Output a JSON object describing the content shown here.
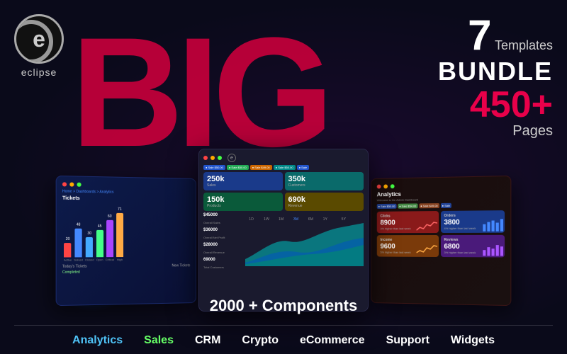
{
  "logo": {
    "symbol": "e",
    "name": "eclipse"
  },
  "hero": {
    "big_text": "BIG",
    "bundle_count": "7",
    "templates_label": "Templates",
    "bundle_label": "BUNDLE",
    "pages_count": "450+",
    "pages_label": "Pages",
    "components_label": "2000 + Components"
  },
  "left_dashboard": {
    "title": "Analytics",
    "breadcrumb": "Home > Dashboards > Analytics",
    "section": "Tickets",
    "bars": [
      {
        "label": "Active",
        "value": 20,
        "color": "#ff4444"
      },
      {
        "label": "Solved",
        "value": 48,
        "color": "#4488ff"
      },
      {
        "label": "Closed",
        "value": 30,
        "color": "#44aaff"
      },
      {
        "label": "Open",
        "value": 45,
        "color": "#44ff88"
      },
      {
        "label": "Critical",
        "value": 60,
        "color": "#aa44ff"
      },
      {
        "label": "High",
        "value": 71,
        "color": "#ffaa44"
      }
    ],
    "today_tickets": "Today's Tickets",
    "new_tickets": "New Tickets",
    "completed": "Completed"
  },
  "center_dashboard": {
    "sale_badges": [
      {
        "label": "Sale $50.00",
        "color": "blue"
      },
      {
        "label": "Sale $50.00",
        "color": "green"
      },
      {
        "label": "Sale $49.00",
        "color": "orange"
      },
      {
        "label": "Sale $50.00",
        "color": "teal"
      },
      {
        "label": "Sale",
        "color": "blue"
      }
    ],
    "stats": [
      {
        "value": "250k",
        "label": "Sales",
        "type": "blue"
      },
      {
        "value": "350k",
        "label": "Customers",
        "type": "teal"
      },
      {
        "value": "150k",
        "label": "Products",
        "type": "green"
      },
      {
        "value": "690k",
        "label": "Revenue",
        "type": "gold"
      }
    ],
    "chart_values": [
      {
        "label": "$45000",
        "desc": "Overall Sales"
      },
      {
        "label": "$36000",
        "desc": "Overall Net Profit"
      },
      {
        "label": "$28000",
        "desc": "Overall Revenue"
      },
      {
        "label": "69000",
        "desc": "Total Customers"
      }
    ]
  },
  "right_dashboard": {
    "title": "Analytics",
    "breadcrumb": "Welcome to the Admin Dashboard",
    "sale_badges": [
      {
        "label": "Sale $50.00"
      },
      {
        "label": "Sale $54.00"
      },
      {
        "label": "Sale $49.00"
      },
      {
        "label": "Sale"
      }
    ],
    "stats": [
      {
        "title": "Clicks",
        "value": "8900",
        "change": "3% higher than last week",
        "type": "red"
      },
      {
        "title": "Orders",
        "value": "3800",
        "change": "4% higher than last week",
        "type": "blue"
      },
      {
        "title": "Income",
        "value": "9600",
        "change": "5% higher than last week",
        "type": "orange"
      },
      {
        "title": "Reviews",
        "value": "6800",
        "change": "3% higher than last week",
        "type": "purple"
      }
    ]
  },
  "bottom_nav": {
    "items": [
      {
        "label": "Analytics",
        "color": "analytics"
      },
      {
        "label": "Sales",
        "color": "sales"
      },
      {
        "label": "CRM",
        "color": "default"
      },
      {
        "label": "Crypto",
        "color": "default"
      },
      {
        "label": "eCommerce",
        "color": "default"
      },
      {
        "label": "Support",
        "color": "default"
      },
      {
        "label": "Widgets",
        "color": "default"
      }
    ]
  }
}
